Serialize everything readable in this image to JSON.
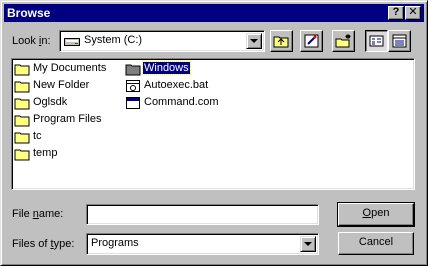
{
  "window": {
    "title": "Browse",
    "help_glyph": "?",
    "close_glyph": "✕"
  },
  "lookin": {
    "label_prefix": "Look ",
    "label_key": "i",
    "label_suffix": "n:",
    "value": "System (C:)"
  },
  "toolbar": [
    {
      "name": "up-one-level-button",
      "icon": "up-folder-icon"
    },
    {
      "name": "desktop-button",
      "icon": "desktop-icon"
    },
    {
      "name": "create-new-folder-button",
      "icon": "new-folder-icon"
    },
    {
      "name": "list-view-button",
      "icon": "list-view-icon"
    },
    {
      "name": "details-view-button",
      "icon": "details-view-icon"
    }
  ],
  "files": {
    "column1": [
      "My Documents",
      "New Folder",
      "Oglsdk",
      "Program Files",
      "tc",
      "temp"
    ],
    "column2": [
      {
        "label": "Windows",
        "type": "folder",
        "selected": true
      },
      {
        "label": "Autoexec.bat",
        "type": "batch"
      },
      {
        "label": "Command.com",
        "type": "app"
      }
    ]
  },
  "filename": {
    "label_prefix": "File ",
    "label_key": "n",
    "label_suffix": "ame:",
    "value": ""
  },
  "filetype": {
    "label_prefix": "Files of ",
    "label_key": "t",
    "label_suffix": "ype:",
    "value": "Programs"
  },
  "buttons": {
    "open_key": "O",
    "open_rest": "pen",
    "cancel": "Cancel"
  },
  "colors": {
    "title_bg": "#000080",
    "face": "#c0c0c0",
    "selection": "#000080",
    "folder": "#ffff80"
  }
}
